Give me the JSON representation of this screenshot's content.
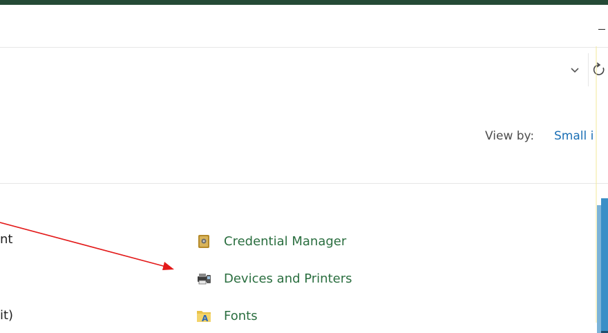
{
  "window": {
    "title_bar_minimize": "minimize"
  },
  "address_bar": {
    "dropdown_icon": "chevron-down-icon",
    "refresh_icon": "refresh-icon"
  },
  "view": {
    "label": "View by:",
    "value": "Small i"
  },
  "left_column_fragments": [
    {
      "text": "nt"
    },
    {
      "text": "it)"
    }
  ],
  "items": [
    {
      "label": "Credential Manager",
      "icon": "credential-manager-icon"
    },
    {
      "label": "Devices and Printers",
      "icon": "devices-printers-icon"
    },
    {
      "label": "Fonts",
      "icon": "fonts-icon"
    }
  ],
  "annotation": {
    "color": "#e31a1a",
    "target": "Devices and Printers"
  },
  "colors": {
    "item_link": "#2a6e3f",
    "view_value": "#1a6fb5",
    "top_border": "#254a36"
  }
}
